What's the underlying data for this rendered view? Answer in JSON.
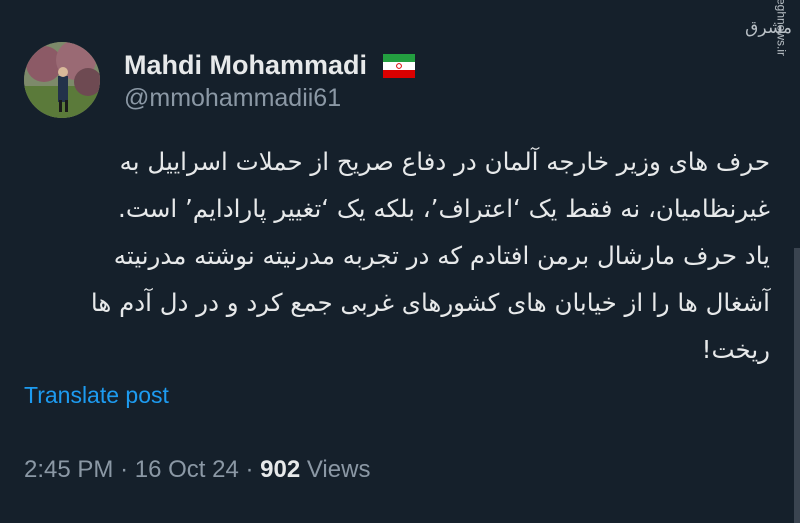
{
  "author": {
    "display_name": "Mahdi Mohammadi",
    "handle": "@mmohammadii61",
    "flag_icon": "iran-flag-icon"
  },
  "post": {
    "text": "حرف های وزیر خارجه آلمان در دفاع صریح از حملات اسراییل به\nغیرنظامیان، نه فقط یک ‘اعتراف’، بلکه یک ‘تغییر پارادایم’ است.\nیاد حرف مارشال برمن افتادم که در تجربه مدرنیته نوشته مدرنیته\nآشغال ها را از خیابان های کشورهای غربی جمع کرد و در دل آدم ها\nریخت!",
    "translate_label": "Translate post"
  },
  "meta": {
    "time": "2:45 PM",
    "separator": "·",
    "date": "16 Oct 24",
    "views_count": "902",
    "views_label": "Views"
  },
  "watermark": {
    "logo_text": "مشرق",
    "site": "mashreghnews.ir"
  },
  "colors": {
    "background": "#15202b",
    "text_primary": "#e7e9ea",
    "text_secondary": "#8b98a5",
    "link": "#1d9bf0"
  }
}
